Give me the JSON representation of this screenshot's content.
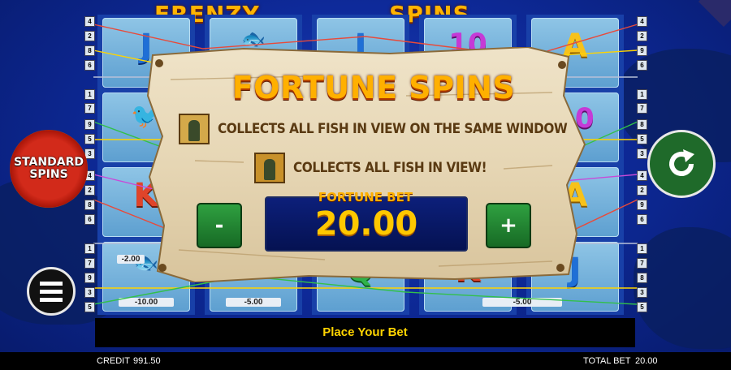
{
  "logo": {
    "left_text": "FISHIN' FRENZY",
    "right_text": "FORTUNE SPINS"
  },
  "fortune_panel": {
    "title": "FORTUNE SPINS",
    "info_1": "COLLECTS ALL FISH IN VIEW ON THE SAME WINDOW",
    "info_2": "COLLECTS ALL FISH IN VIEW!",
    "bet_label": "FORTUNE BET",
    "bet_value": "20.00",
    "minus_label": "-",
    "plus_label": "+"
  },
  "side": {
    "standard_spins": "STANDARD SPINS"
  },
  "reels": {
    "cash_values": [
      "-2.00",
      "-10.00",
      "-5.00",
      "-5.00"
    ],
    "left_line_numbers": [
      "4",
      "2",
      "8",
      "6",
      "1",
      "7",
      "9",
      "5",
      "3",
      "4",
      "2",
      "8",
      "6",
      "1",
      "7",
      "9",
      "3",
      "5"
    ],
    "right_line_numbers": [
      "4",
      "2",
      "9",
      "6",
      "1",
      "7",
      "8",
      "5",
      "3",
      "4",
      "2",
      "9",
      "6",
      "1",
      "7",
      "8",
      "3",
      "5"
    ]
  },
  "bottom": {
    "message": "Place Your Bet"
  },
  "footer": {
    "credit_label": "CREDIT",
    "credit_value": "991.50",
    "total_bet_label": "TOTAL BET",
    "total_bet_value": "20.00"
  },
  "colors": {
    "accent": "#ffb000",
    "green": "#1f6a2a",
    "board": "#e9dcc0"
  }
}
